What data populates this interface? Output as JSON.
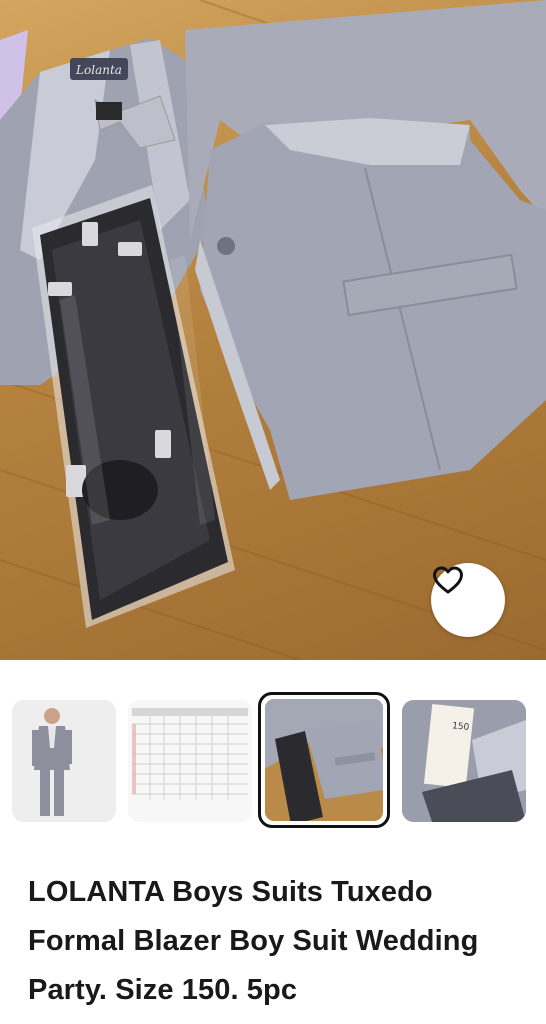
{
  "product": {
    "title": "LOLANTA Boys Suits Tuxedo Formal Blazer Boy Suit Wedding Party. Size 150. 5pc",
    "brand_label_on_photo": "Lolanta",
    "size_tag_on_photo": "150"
  },
  "gallery": {
    "thumbnails": [
      {
        "label": "boy-in-suit-photo",
        "selected": false
      },
      {
        "label": "size-chart-photo",
        "selected": false
      },
      {
        "label": "suit-pieces-photo",
        "selected": true
      },
      {
        "label": "size-tag-photo",
        "selected": false
      }
    ]
  },
  "icons": {
    "favorite": "heart-outline-icon"
  },
  "colors": {
    "suit_grey": "#a2a5b3",
    "wood": "#b98a48",
    "text": "#191919"
  }
}
